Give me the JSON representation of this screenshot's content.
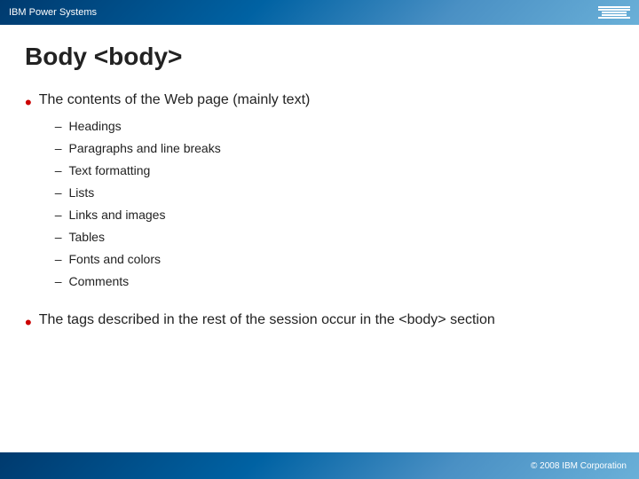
{
  "topbar": {
    "title": "IBM Power Systems"
  },
  "page": {
    "title": "Body <body>"
  },
  "bullets": [
    {
      "text": "The contents of the Web page (mainly text)",
      "subitems": [
        "Headings",
        "Paragraphs and line breaks",
        "Text formatting",
        "Lists",
        "Links and images",
        "Tables",
        "Fonts and colors",
        "Comments"
      ]
    },
    {
      "text": "The tags described in the rest of the session occur in the <body> section",
      "subitems": []
    }
  ],
  "footer": {
    "copyright": "© 2008 IBM Corporation"
  }
}
